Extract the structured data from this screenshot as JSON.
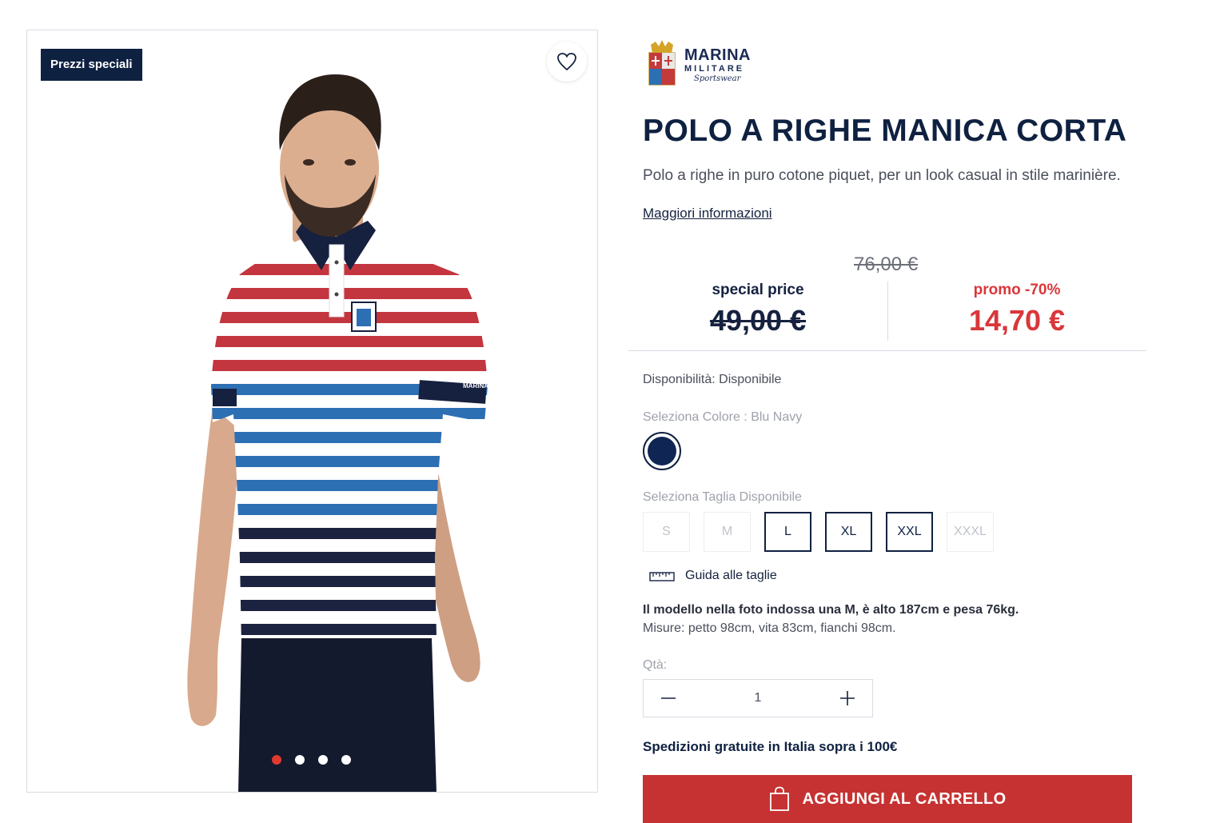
{
  "gallery": {
    "badge": "Prezzi speciali",
    "wishlist_icon": "heart-icon",
    "slide_count": 4,
    "active_slide": 1
  },
  "brand": {
    "line1": "MARINA",
    "line2": "MILITARE",
    "line3": "Sportswear"
  },
  "product": {
    "title": "POLO A RIGHE MANICA CORTA",
    "description": "Polo a righe in puro cotone piquet, per un look casual in stile marinière.",
    "more_link": "Maggiori informazioni"
  },
  "pricing": {
    "original": "76,00 €",
    "special_label": "special price",
    "special_value": "49,00 €",
    "promo_label": "promo -70%",
    "promo_value": "14,70 €"
  },
  "availability": "Disponibilità: Disponibile",
  "color": {
    "label": "Seleziona Colore : Blu Navy",
    "selected_hex": "#0f2655"
  },
  "size": {
    "label": "Seleziona Taglia Disponibile",
    "options": [
      {
        "label": "S",
        "available": false
      },
      {
        "label": "M",
        "available": false
      },
      {
        "label": "L",
        "available": true
      },
      {
        "label": "XL",
        "available": true
      },
      {
        "label": "XXL",
        "available": true
      },
      {
        "label": "XXXL",
        "available": false
      }
    ],
    "guide": "Guida alle taglie"
  },
  "model_info": {
    "line1": "Il modello nella foto indossa una M, è alto 187cm e pesa 76kg.",
    "line2": "Misure: petto 98cm, vita 83cm, fianchi 98cm."
  },
  "quantity": {
    "label": "Qtà:",
    "value": "1",
    "minus": "−",
    "plus": "+"
  },
  "shipping": "Spedizioni gratuite in Italia sopra i 100€",
  "cart_button": "AGGIUNGI AL CARRELLO",
  "colors": {
    "navy": "#0f2141",
    "promo_red": "#d9373a",
    "cart_red": "#c63232",
    "stripe_red": "#c4363f",
    "stripe_blue": "#2d6fb3",
    "stripe_navy": "#1b2340"
  }
}
